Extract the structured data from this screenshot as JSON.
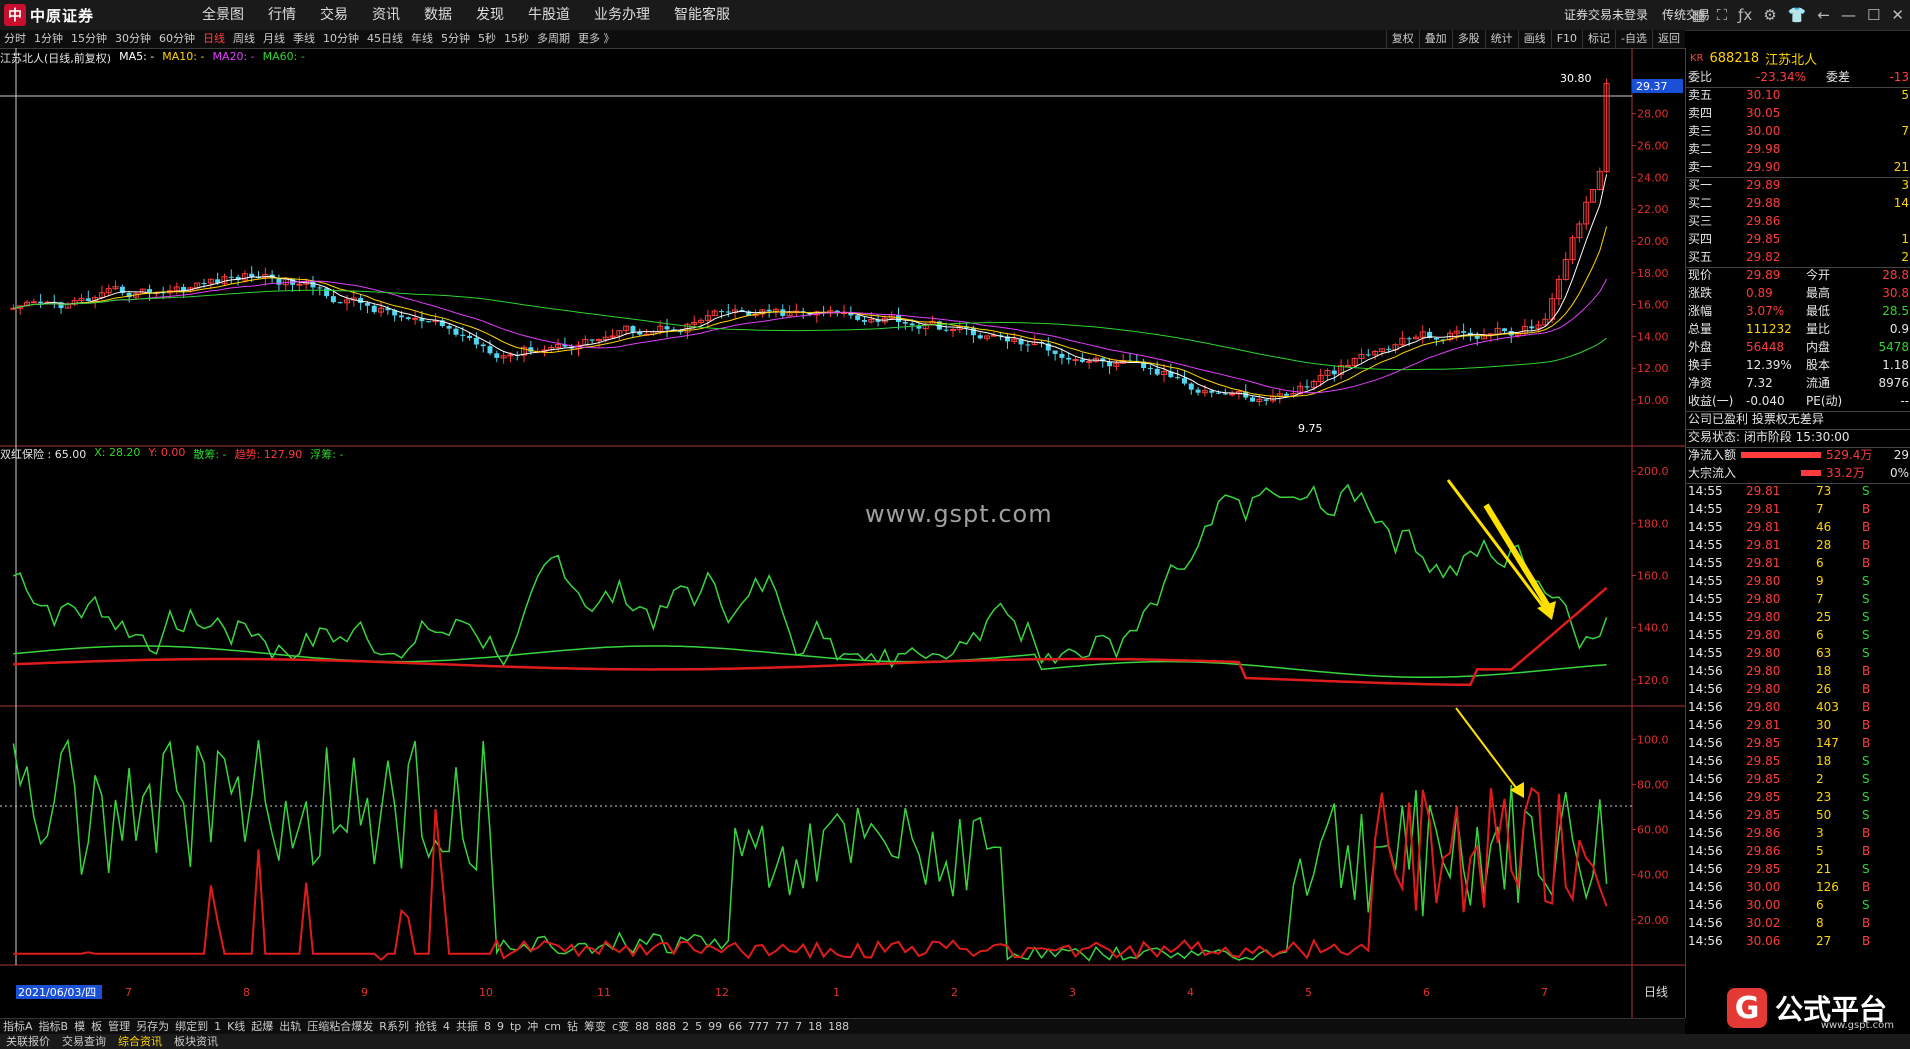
{
  "app": {
    "logo_text": "中原证券",
    "menu": [
      "全景图",
      "行情",
      "交易",
      "资讯",
      "数据",
      "发现",
      "牛股道",
      "业务办理",
      "智能客服"
    ],
    "top_right": [
      "证券交易未登录",
      "传统交易"
    ],
    "icons": [
      "grid-icon",
      "fullscreen-icon",
      "formula-icon",
      "gear-icon",
      "shirt-icon",
      "back-icon",
      "minimize-icon",
      "maximize-icon",
      "close-icon"
    ]
  },
  "period_bar": [
    "分时",
    "1分钟",
    "15分钟",
    "30分钟",
    "60分钟",
    "日线",
    "周线",
    "月线",
    "季线",
    "10分钟",
    "45日线",
    "年线",
    "5分钟",
    "5秒",
    "15秒",
    "多周期",
    "更多 》"
  ],
  "period_active": "日线",
  "tool_right": [
    "复权",
    "叠加",
    "多股",
    "统计",
    "画线",
    "F10",
    "标记",
    "-自选",
    "返回"
  ],
  "chart_header": {
    "title": "江苏北人(日线,前复权)",
    "ma": [
      {
        "label": "MA5: -",
        "color": "#ffffff"
      },
      {
        "label": "MA10: -",
        "color": "#ffd400"
      },
      {
        "label": "MA20: -",
        "color": "#e040fb"
      },
      {
        "label": "MA60: -",
        "color": "#2ed52e"
      }
    ],
    "price_label": "29.37",
    "high_label": "30.80",
    "low_label": "9.75",
    "price_ticks": [
      "28.00",
      "26.00",
      "24.00",
      "22.00",
      "20.00",
      "18.00",
      "16.00",
      "14.00",
      "12.00",
      "10.00"
    ]
  },
  "indicator1": {
    "name": "双红保险 : 65.00",
    "x": "X: 28.20",
    "y": "Y: 0.00",
    "sanchou": "散筹: -",
    "qushi": "趋势: 127.90",
    "fuchou": "浮筹: -",
    "ticks": [
      "200.0",
      "180.0",
      "160.0",
      "140.0",
      "120.0"
    ]
  },
  "indicator2": {
    "ticks": [
      "100.0",
      "80.00",
      "60.00",
      "40.00",
      "20.00"
    ]
  },
  "date_label": "2021/06/03/四",
  "x_months": [
    "7",
    "8",
    "9",
    "10",
    "11",
    "12",
    "1",
    "2",
    "3",
    "4",
    "5",
    "6",
    "7"
  ],
  "watermark": "www.gspt.com",
  "right_panel": {
    "kr": "KR",
    "code": "688218",
    "name": "江苏北人",
    "webi": {
      "label": "委比",
      "value": "-23.34%",
      "label2": "委差",
      "value2": "-13"
    },
    "sell": [
      {
        "label": "卖五",
        "price": "30.10",
        "vol": "5"
      },
      {
        "label": "卖四",
        "price": "30.05",
        "vol": ""
      },
      {
        "label": "卖三",
        "price": "30.00",
        "vol": "7"
      },
      {
        "label": "卖二",
        "price": "29.98",
        "vol": ""
      },
      {
        "label": "卖一",
        "price": "29.90",
        "vol": "21"
      }
    ],
    "buy": [
      {
        "label": "买一",
        "price": "29.89",
        "vol": "3"
      },
      {
        "label": "买二",
        "price": "29.88",
        "vol": "14"
      },
      {
        "label": "买三",
        "price": "29.86",
        "vol": ""
      },
      {
        "label": "买四",
        "price": "29.85",
        "vol": "1"
      },
      {
        "label": "买五",
        "price": "29.82",
        "vol": "2"
      }
    ],
    "stats": [
      {
        "l": "现价",
        "v": "29.89",
        "l2": "今开",
        "v2": "28.8"
      },
      {
        "l": "涨跌",
        "v": "0.89",
        "l2": "最高",
        "v2": "30.8"
      },
      {
        "l": "涨幅",
        "v": "3.07%",
        "l2": "最低",
        "v2": "28.5"
      },
      {
        "l": "总量",
        "v": "111232",
        "l2": "量比",
        "v2": "0.9"
      },
      {
        "l": "外盘",
        "v": "56448",
        "l2": "内盘",
        "v2": "5478"
      },
      {
        "l": "换手",
        "v": "12.39%",
        "l2": "股本",
        "v2": "1.18"
      },
      {
        "l": "净资",
        "v": "7.32",
        "l2": "流通",
        "v2": "8976"
      },
      {
        "l": "收益(一)",
        "v": "-0.040",
        "l2": "PE(动)",
        "v2": "--"
      }
    ],
    "status1": "公司已盈利  投票权无差异",
    "status2": "交易状态: 闭市阶段 15:30:00",
    "flow": [
      {
        "l": "净流入额",
        "v": "529.4万",
        "p": "29"
      },
      {
        "l": "大宗流入",
        "v": "33.2万",
        "p": "0%"
      }
    ],
    "ticks": [
      {
        "t": "14:55",
        "p": "29.81",
        "v": "73",
        "s": "S"
      },
      {
        "t": "14:55",
        "p": "29.81",
        "v": "7",
        "s": "B"
      },
      {
        "t": "14:55",
        "p": "29.81",
        "v": "46",
        "s": "B"
      },
      {
        "t": "14:55",
        "p": "29.81",
        "v": "28",
        "s": "B"
      },
      {
        "t": "14:55",
        "p": "29.81",
        "v": "6",
        "s": "B"
      },
      {
        "t": "14:55",
        "p": "29.80",
        "v": "9",
        "s": "S"
      },
      {
        "t": "14:55",
        "p": "29.80",
        "v": "7",
        "s": "S"
      },
      {
        "t": "14:55",
        "p": "29.80",
        "v": "25",
        "s": "S"
      },
      {
        "t": "14:55",
        "p": "29.80",
        "v": "6",
        "s": "S"
      },
      {
        "t": "14:55",
        "p": "29.80",
        "v": "63",
        "s": "S"
      },
      {
        "t": "14:56",
        "p": "29.80",
        "v": "18",
        "s": "B"
      },
      {
        "t": "14:56",
        "p": "29.80",
        "v": "26",
        "s": "B"
      },
      {
        "t": "14:56",
        "p": "29.80",
        "v": "403",
        "s": "B"
      },
      {
        "t": "14:56",
        "p": "29.81",
        "v": "30",
        "s": "B"
      },
      {
        "t": "14:56",
        "p": "29.85",
        "v": "147",
        "s": "B"
      },
      {
        "t": "14:56",
        "p": "29.85",
        "v": "18",
        "s": "S"
      },
      {
        "t": "14:56",
        "p": "29.85",
        "v": "2",
        "s": "S"
      },
      {
        "t": "14:56",
        "p": "29.85",
        "v": "23",
        "s": "S"
      },
      {
        "t": "14:56",
        "p": "29.85",
        "v": "50",
        "s": "S"
      },
      {
        "t": "14:56",
        "p": "29.86",
        "v": "3",
        "s": "B"
      },
      {
        "t": "14:56",
        "p": "29.86",
        "v": "5",
        "s": "B"
      },
      {
        "t": "14:56",
        "p": "29.85",
        "v": "21",
        "s": "S"
      },
      {
        "t": "14:56",
        "p": "30.00",
        "v": "126",
        "s": "B"
      },
      {
        "t": "14:56",
        "p": "30.00",
        "v": "6",
        "s": "S"
      },
      {
        "t": "14:56",
        "p": "30.02",
        "v": "8",
        "s": "B"
      },
      {
        "t": "14:56",
        "p": "30.06",
        "v": "27",
        "s": "B"
      }
    ],
    "daily_label": "日线"
  },
  "bottom_bar1": [
    "指标A",
    "指标B",
    "模",
    "板",
    "管理",
    "另存为",
    "绑定到",
    "1",
    "K线",
    "起爆",
    "出轨",
    "压缩粘合爆发",
    "R系列",
    "抢钱",
    "4",
    "共振",
    "8",
    "9",
    "tp",
    "冲",
    "cm",
    "钻",
    "筹变",
    "c变",
    "88",
    "888",
    "2",
    "5",
    "99",
    "66",
    "777",
    "77",
    "7",
    "18",
    "188"
  ],
  "bottom_bar2": [
    "关联报价",
    "交易查询",
    "综合资讯",
    "板块资讯"
  ],
  "bottom_bar2_active": "综合资讯",
  "brand": {
    "name": "公式平台",
    "url": "www.gspt.com"
  }
}
